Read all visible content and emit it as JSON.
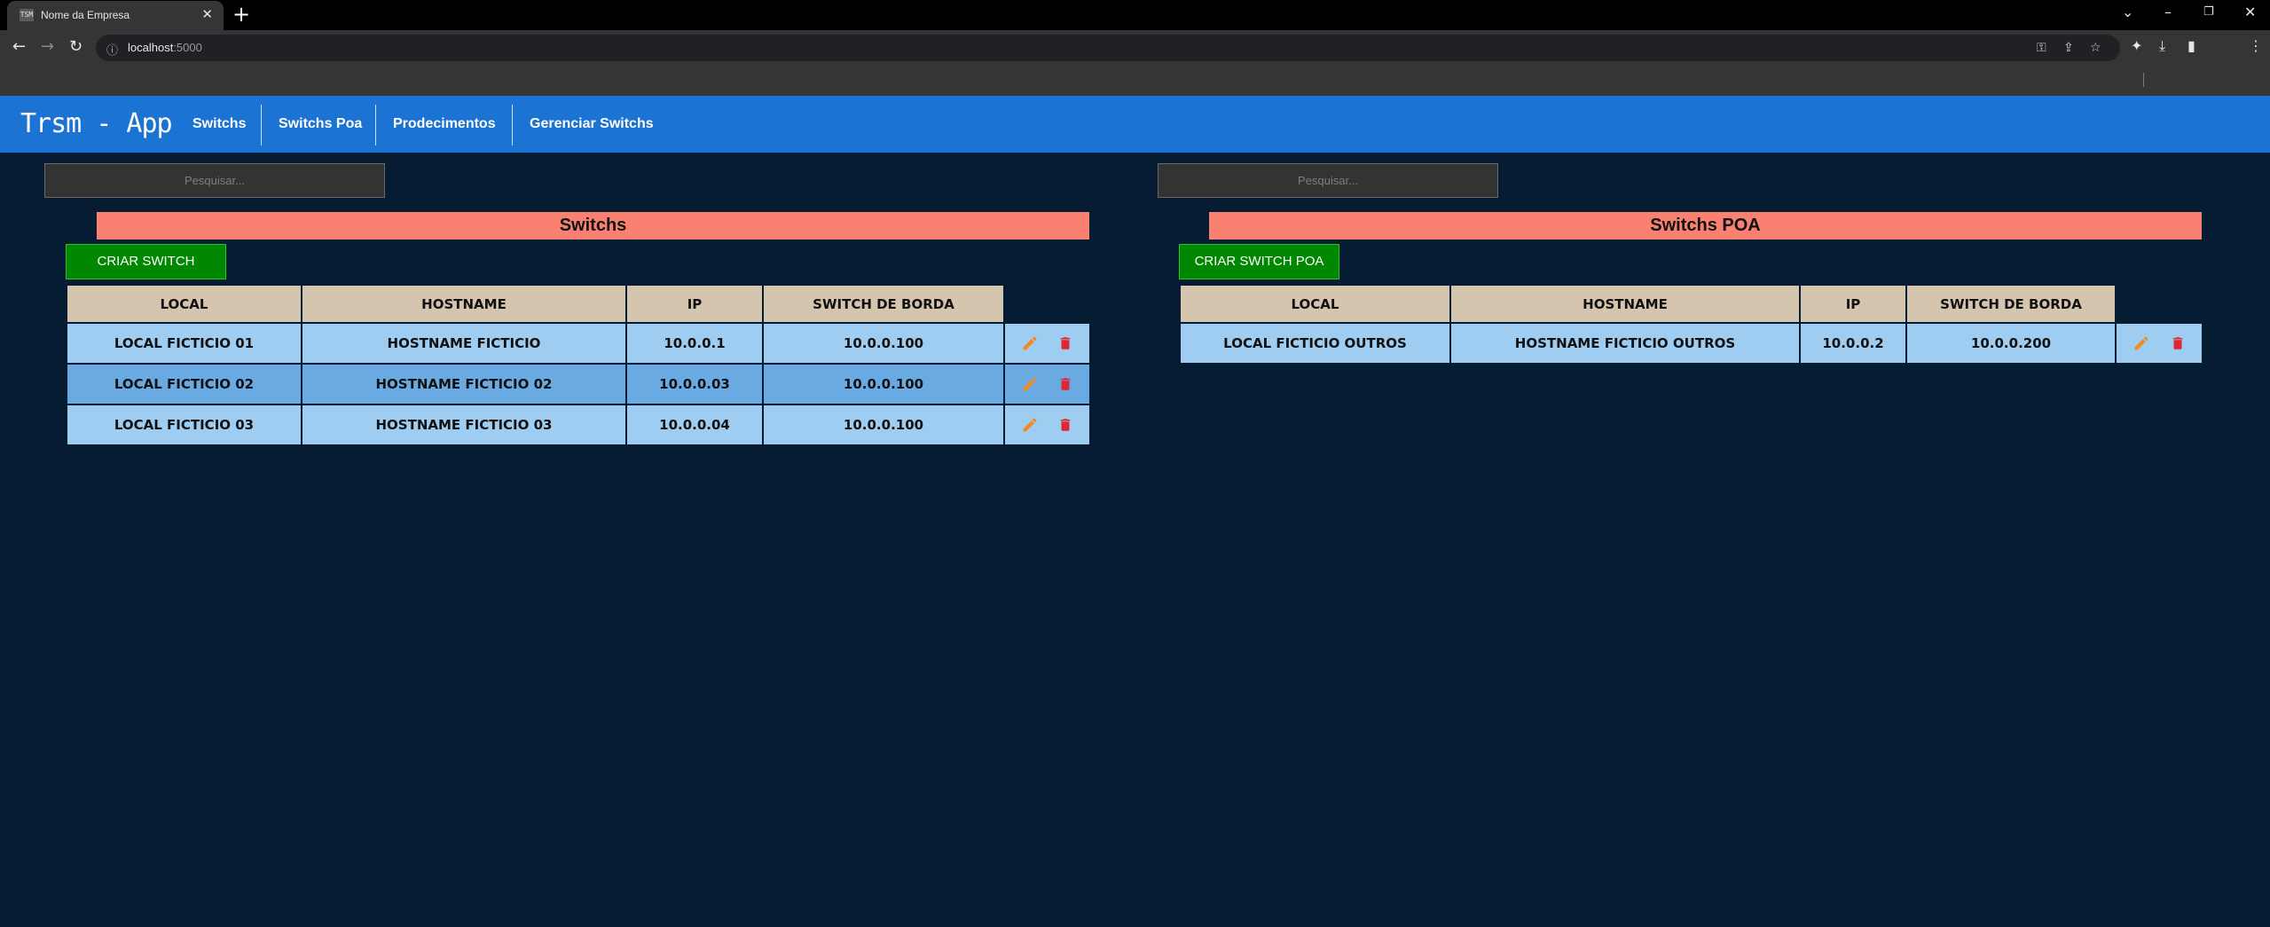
{
  "browser": {
    "tab_title": "Nome da Empresa",
    "tab_favicon": "TSM",
    "url_host": "localhost",
    "url_port": ":5000"
  },
  "nav": {
    "brand": "Trsm - App",
    "links": [
      "Switchs",
      "Switchs Poa",
      "Prodecimentos",
      "Gerenciar Switchs"
    ]
  },
  "colors": {
    "nav_bg": "#1b73d3",
    "page_bg": "#061c33",
    "title_bar": "#fa8072",
    "create_button": "#008800",
    "header_cell": "#d5c4ae",
    "row_light": "#9fcdf2",
    "row_dark": "#6aaae2",
    "edit_icon": "#f08a24",
    "delete_icon": "#e0262f"
  },
  "icons": {
    "row_edit": "pencil-icon",
    "row_delete": "trash-icon"
  },
  "left_panel": {
    "search_placeholder": "Pesquisar...",
    "title": "Switchs",
    "create_label": "CRIAR SWITCH",
    "columns": [
      "LOCAL",
      "HOSTNAME",
      "IP",
      "SWITCH DE BORDA"
    ],
    "rows": [
      {
        "local": "LOCAL FICTICIO 01",
        "hostname": "HOSTNAME FICTICIO",
        "ip": "10.0.0.1",
        "borda": "10.0.0.100"
      },
      {
        "local": "LOCAL FICTICIO 02",
        "hostname": "HOSTNAME FICTICIO 02",
        "ip": "10.0.0.03",
        "borda": "10.0.0.100"
      },
      {
        "local": "LOCAL FICTICIO 03",
        "hostname": "HOSTNAME FICTICIO 03",
        "ip": "10.0.0.04",
        "borda": "10.0.0.100"
      }
    ]
  },
  "right_panel": {
    "search_placeholder": "Pesquisar...",
    "title": "Switchs POA",
    "create_label": "CRIAR SWITCH POA",
    "columns": [
      "LOCAL",
      "HOSTNAME",
      "IP",
      "SWITCH DE BORDA"
    ],
    "rows": [
      {
        "local": "LOCAL FICTICIO OUTROS",
        "hostname": "HOSTNAME FICTICIO OUTROS",
        "ip": "10.0.0.2",
        "borda": "10.0.0.200"
      }
    ]
  }
}
